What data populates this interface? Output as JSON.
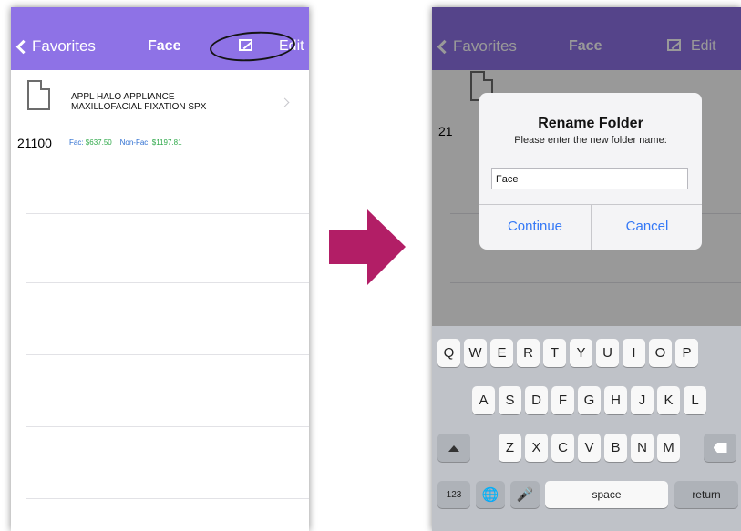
{
  "left_screen": {
    "nav": {
      "back_label": "Favorites",
      "title": "Face",
      "edit_label": "Edit"
    },
    "item": {
      "line1": "APPL HALO APPLIANCE",
      "line2": "MAXILLOFACIAL FIXATION SPX",
      "code": "21100",
      "fac_label": "Fac:",
      "fac_value": "$637.50",
      "nonfac_label": "Non-Fac:",
      "nonfac_value": "$1197.81"
    }
  },
  "right_screen": {
    "dialog": {
      "title": "Rename Folder",
      "message": "Please enter the new folder name:",
      "input_value": "Face",
      "continue_label": "Continue",
      "cancel_label": "Cancel"
    },
    "keyboard": {
      "row1": [
        "Q",
        "W",
        "E",
        "R",
        "T",
        "Y",
        "U",
        "I",
        "O",
        "P"
      ],
      "row2": [
        "A",
        "S",
        "D",
        "F",
        "G",
        "H",
        "J",
        "K",
        "L"
      ],
      "row3": [
        "Z",
        "X",
        "C",
        "V",
        "B",
        "N",
        "M"
      ],
      "numbers_label": "123",
      "space_label": "space",
      "return_label": "return"
    }
  },
  "colors": {
    "nav_bar": "#8e72e6",
    "arrow": "#b21e66",
    "link_blue": "#3478f6",
    "fee_green": "#2fa94a"
  }
}
